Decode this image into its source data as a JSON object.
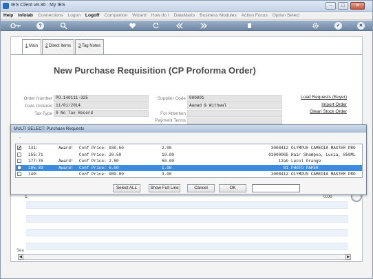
{
  "window": {
    "title": "IES Client v8.36 : My IES",
    "controls": {
      "minimize": "–",
      "maximize": "□",
      "close": "✕"
    }
  },
  "menu": [
    {
      "label": "Help",
      "bold": true
    },
    {
      "label": "Infolab",
      "bold": true
    },
    {
      "label": "Connections",
      "bold": false
    },
    {
      "label": "Logon",
      "bold": false
    },
    {
      "label": "Logoff",
      "bold": true
    },
    {
      "label": "Companion",
      "bold": false
    },
    {
      "label": "Wizard",
      "bold": false
    },
    {
      "label": "How do I",
      "bold": false
    },
    {
      "label": "DataMarts",
      "bold": false
    },
    {
      "label": "Business Modules",
      "bold": false
    },
    {
      "label": "Action Focus",
      "bold": false
    },
    {
      "label": "Option Select",
      "bold": false
    }
  ],
  "toolbar": {
    "icons": [
      "key-icon",
      "help-icon",
      "search-icon",
      "heart-icon",
      "refresh-icon",
      "rewind-icon",
      "fast-forward-icon",
      "stop-icon",
      "settings-icon",
      "ok-icon",
      "close-icon"
    ],
    "glyphs": {
      "help": "?",
      "ok": "✓",
      "close": "✕"
    }
  },
  "tabs": [
    {
      "num": "1",
      "label": "Main",
      "active": true
    },
    {
      "num": "2",
      "label": "Direct Items",
      "active": false
    },
    {
      "num": "3",
      "label": "Tag Notes",
      "active": false
    }
  ],
  "page_title": "New Purchase  Requisition (CP Proforma Order)",
  "form": {
    "order_number": {
      "label": "Order Number",
      "value": "PO.140111-325"
    },
    "date_ordered": {
      "label": "Date Ordered",
      "value": "11/01/2014"
    },
    "tax_type": {
      "label": "Tax Type",
      "value": "0 No Tax Record"
    },
    "supplier_code": {
      "label": "Supplier Code",
      "value": "000001",
      "name": "Aanad & Withwal"
    },
    "for_attention": {
      "label": "For Attention",
      "value": ""
    },
    "payment_terms": {
      "label": "Payment Terms",
      "value": ""
    }
  },
  "links": {
    "load_requests": "Load Requests (Buyer)",
    "import_order": "Import Order",
    "glean_stock": "Glean Stock Order"
  },
  "grid": {
    "row_number": "1",
    "value": "0.00",
    "side_label": "Sea"
  },
  "dialog": {
    "title": "MULTI SELECT: Purchase Requests",
    "dash": "-",
    "rows": [
      {
        "id": "141:",
        "award": "Award!",
        "price": "Conf Price: 939.50",
        "qty": "2.00",
        "code": "3008412",
        "desc": "OLYMPUS CAMEDIA MASTER PRO",
        "checked": true,
        "selected": false
      },
      {
        "id": "155:71",
        "award": "",
        "price": "Conf Price: 20.50",
        "qty": "10.00",
        "code": "01000005",
        "desc": "Hair Shampoo, Lucia, 850ML",
        "checked": false,
        "selected": false
      },
      {
        "id": "177:76",
        "award": "Award!",
        "price": "Conf Price: 2.80",
        "qty": "50.00",
        "code": "12ab",
        "desc": "Lecol Orange",
        "checked": false,
        "selected": false
      },
      {
        "id": "195:89",
        "award": "Award!",
        "price": "Conf Price: 6.00",
        "qty": "1.00",
        "code": "01",
        "desc": "PHOTO PAPER",
        "checked": false,
        "selected": true
      },
      {
        "id": "140:",
        "award": "",
        "price": "Conf Price: 980.00",
        "qty": "3.00",
        "code": "3008412",
        "desc": "OLYMPUS CAMEDIA MASTER PRO",
        "checked": false,
        "selected": false
      }
    ],
    "buttons": {
      "select_all": "Select ALL",
      "show_full_line": "Show Full Line",
      "cancel": "Cancel",
      "ok": "OK"
    }
  },
  "colors": {
    "accent": "#3b8be0",
    "toolbar": "#7f97b3",
    "titlebar": "#cfdcee"
  }
}
